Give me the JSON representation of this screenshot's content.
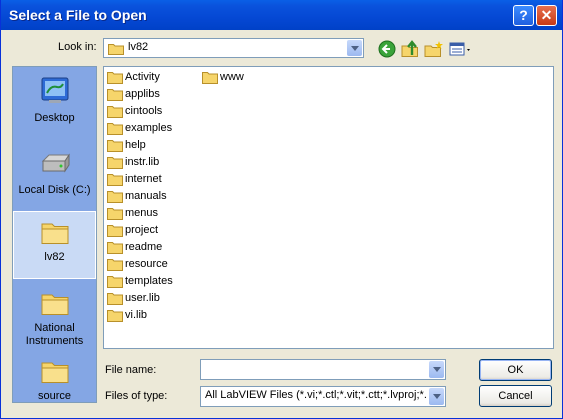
{
  "window": {
    "title": "Select a File to Open",
    "help_label": "?",
    "close_label": "✕"
  },
  "lookin": {
    "label": "Look in:",
    "value": "lv82"
  },
  "places": [
    {
      "label": "Desktop"
    },
    {
      "label": "Local Disk (C:)"
    },
    {
      "label": "lv82"
    },
    {
      "label": "National Instruments"
    },
    {
      "label": "source"
    }
  ],
  "folders": [
    "Activity",
    "applibs",
    "cintools",
    "examples",
    "help",
    "instr.lib",
    "internet",
    "manuals",
    "menus",
    "project",
    "readme",
    "resource",
    "templates",
    "user.lib",
    "vi.lib",
    "www"
  ],
  "filename": {
    "label": "File name:",
    "value": ""
  },
  "filetype": {
    "label": "Files of type:",
    "value": "All LabVIEW Files (*.vi;*.ctl;*.vit;*.ctt;*.lvproj;*.lv"
  },
  "buttons": {
    "ok": "OK",
    "cancel": "Cancel"
  }
}
